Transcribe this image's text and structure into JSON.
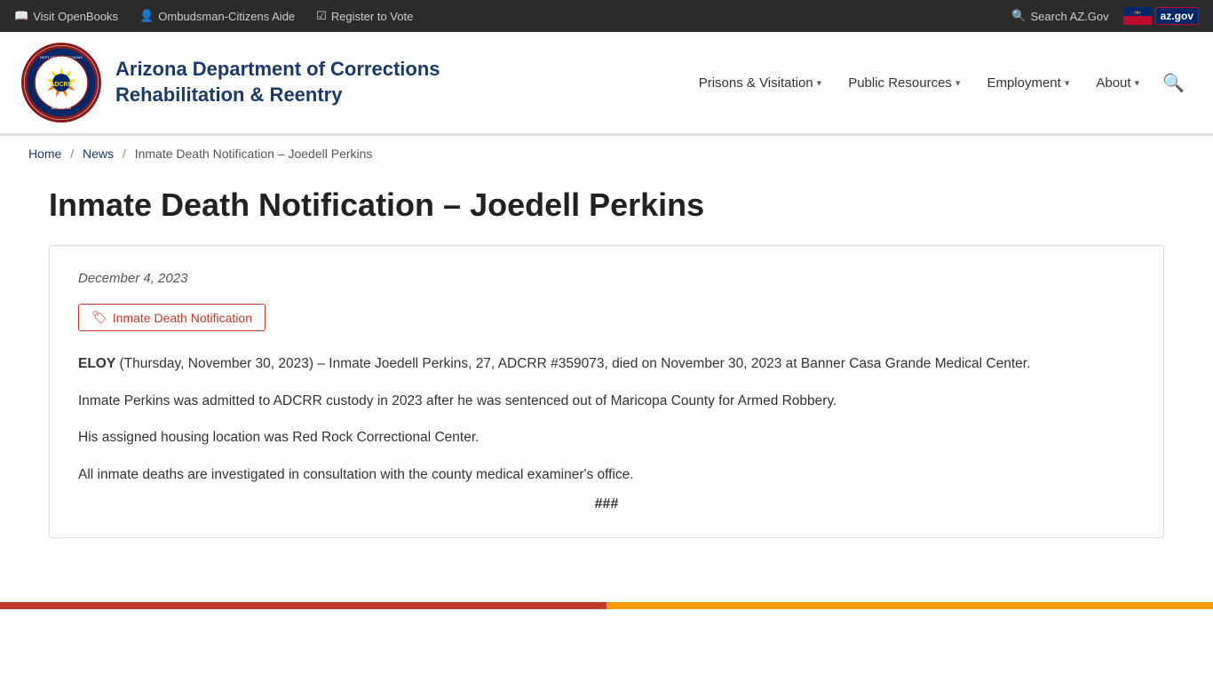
{
  "topbar": {
    "left": [
      {
        "id": "openbooks",
        "icon": "📖",
        "label": "Visit OpenBooks"
      },
      {
        "id": "ombudsman",
        "icon": "👤",
        "label": "Ombudsman-Citizens Aide"
      },
      {
        "id": "register",
        "icon": "🗳",
        "label": "Register to Vote"
      }
    ],
    "right": [
      {
        "id": "search-az",
        "icon": "🔍",
        "label": "Search AZ.Gov"
      },
      {
        "id": "azgov",
        "label": "az.gov"
      }
    ]
  },
  "header": {
    "org_name_line1": "Arizona Department of Corrections",
    "org_name_line2": "Rehabilitation & Reentry",
    "nav": [
      {
        "id": "prisons",
        "label": "Prisons & Visitation",
        "has_dropdown": true
      },
      {
        "id": "public-resources",
        "label": "Public Resources",
        "has_dropdown": true
      },
      {
        "id": "employment",
        "label": "Employment",
        "has_dropdown": true
      },
      {
        "id": "about",
        "label": "About",
        "has_dropdown": true
      }
    ]
  },
  "breadcrumb": {
    "home": "Home",
    "news": "News",
    "current": "Inmate Death Notification – Joedell Perkins"
  },
  "article": {
    "title": "Inmate Death Notification – Joedell Perkins",
    "date": "December 4, 2023",
    "tag": "Inmate Death Notification",
    "city": "ELOY",
    "para1": "(Thursday, November 30, 2023) – Inmate Joedell Perkins, 27, ADCRR #359073, died on November 30, 2023 at Banner Casa Grande Medical Center.",
    "para2": "Inmate Perkins was admitted to ADCRR custody in 2023 after he was sentenced out of Maricopa County for Armed Robbery.",
    "para3": "His assigned housing location was Red Rock Correctional Center.",
    "para4": "All inmate deaths are investigated in consultation with the county medical examiner's office.",
    "end_mark": "###"
  }
}
